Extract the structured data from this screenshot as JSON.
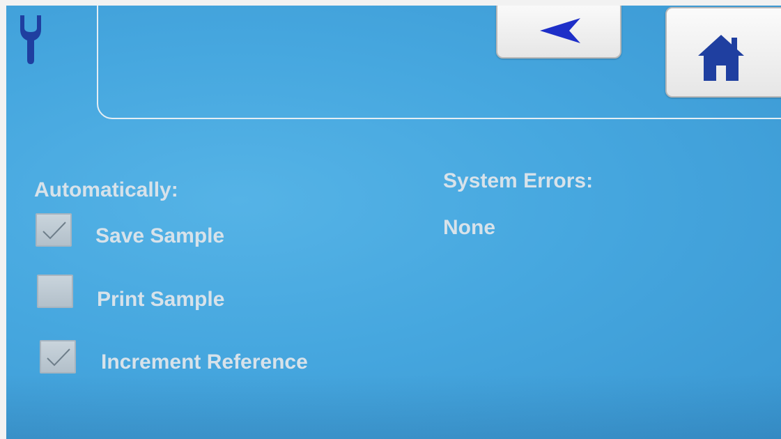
{
  "header": {
    "tab_icon": "wrench-icon",
    "back_icon": "back-arrow-icon",
    "home_icon": "home-icon"
  },
  "automatic": {
    "heading": "Automatically:",
    "options": [
      {
        "label": "Save Sample",
        "checked": true
      },
      {
        "label": "Print Sample",
        "checked": false
      },
      {
        "label": "Increment Reference",
        "checked": true
      }
    ]
  },
  "errors": {
    "heading": "System Errors:",
    "value": "None"
  },
  "colors": {
    "background": "#46a7df",
    "icon_blue": "#1f3fa0",
    "text": "#d7e2ea"
  }
}
